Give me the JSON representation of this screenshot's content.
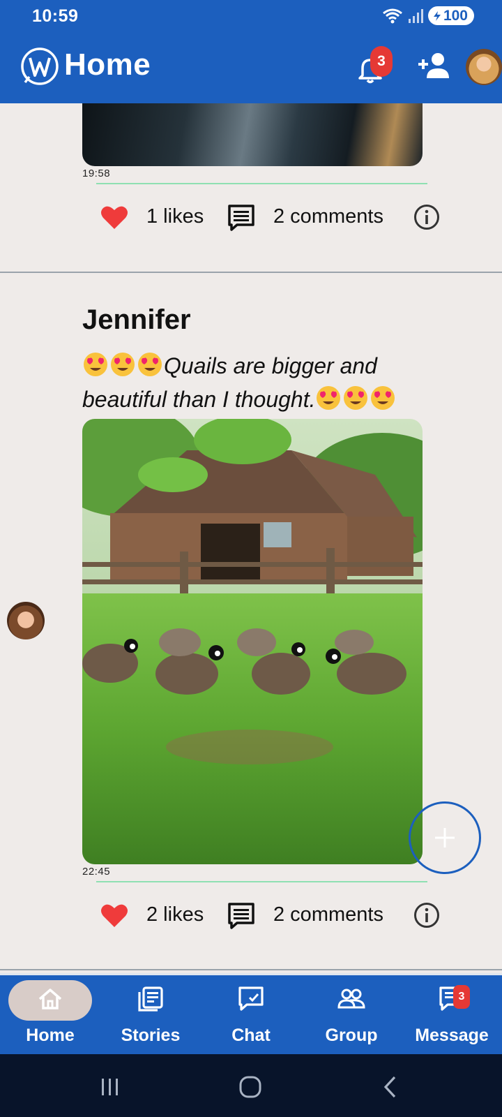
{
  "status_bar": {
    "time": "10:59",
    "battery": "100"
  },
  "app_bar": {
    "title": "Home",
    "notification_count": "3"
  },
  "post_top": {
    "timestamp": "19:58",
    "likes": "1 likes",
    "comments": "2 comments"
  },
  "post_main": {
    "author": "Jennifer",
    "caption_text": "Quails are bigger and beautiful than I thought.",
    "timestamp": "22:45",
    "likes": "2 likes",
    "comments": "2 comments"
  },
  "bottom_nav": {
    "items": [
      {
        "label": "Home"
      },
      {
        "label": "Stories"
      },
      {
        "label": "Chat"
      },
      {
        "label": "Group"
      },
      {
        "label": "Message"
      }
    ],
    "message_badge": "3"
  },
  "colors": {
    "primary": "#1c5fbe",
    "heart": "#ef3b3b",
    "badge": "#e53935",
    "accent_line": "#8fe0b2",
    "background": "#efebe9"
  }
}
